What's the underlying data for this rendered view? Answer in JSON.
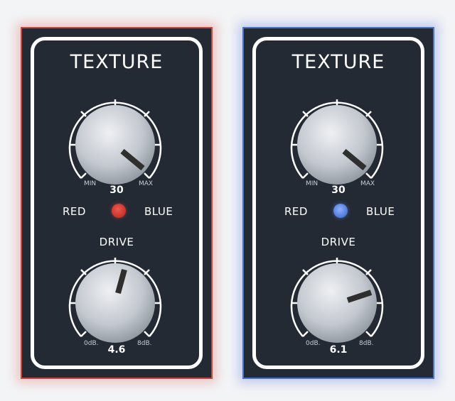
{
  "panels": [
    {
      "title": "TEXTURE",
      "texture_knob": {
        "value": "30",
        "min_label": "MIN",
        "max_label": "MAX"
      },
      "toggle": {
        "left_label": "RED",
        "right_label": "BLUE",
        "state": "RED",
        "led_color": "#d63b33"
      },
      "drive_label": "DRIVE",
      "drive_knob": {
        "value": "4.6",
        "min_label": "0dB.",
        "max_label": "8dB."
      },
      "accent": "#c9473f"
    },
    {
      "title": "TEXTURE",
      "texture_knob": {
        "value": "30",
        "min_label": "MIN",
        "max_label": "MAX"
      },
      "toggle": {
        "left_label": "RED",
        "right_label": "BLUE",
        "state": "BLUE",
        "led_color": "#5b82e0"
      },
      "drive_label": "DRIVE",
      "drive_knob": {
        "value": "6.1",
        "min_label": "0dB.",
        "max_label": "8dB."
      },
      "accent": "#4d73c9"
    }
  ]
}
